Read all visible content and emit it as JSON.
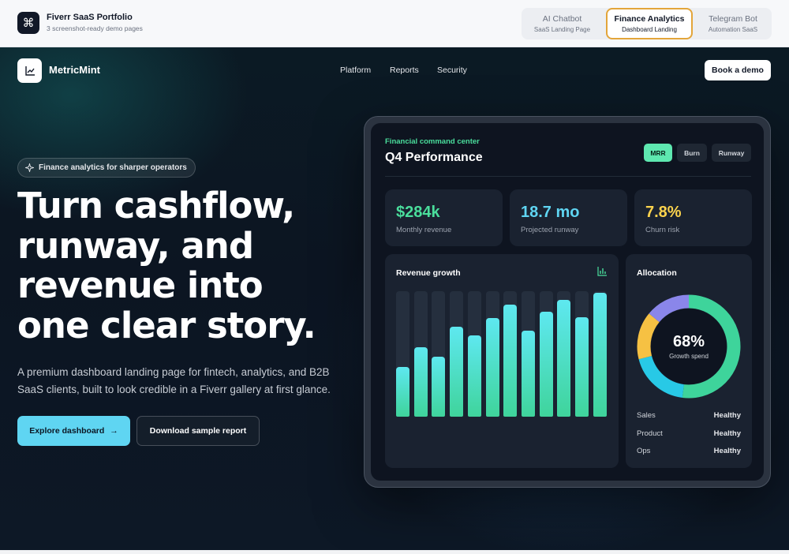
{
  "portfolio": {
    "title": "Fiverr SaaS Portfolio",
    "subtitle": "3 screenshot-ready demo pages",
    "tabs": [
      {
        "label": "AI Chatbot",
        "sub": "SaaS Landing Page",
        "active": false
      },
      {
        "label": "Finance Analytics",
        "sub": "Dashboard Landing",
        "active": true
      },
      {
        "label": "Telegram Bot",
        "sub": "Automation SaaS",
        "active": false
      }
    ]
  },
  "site": {
    "brand": "MetricMint",
    "nav": [
      "Platform",
      "Reports",
      "Security"
    ],
    "cta": "Book a demo"
  },
  "hero": {
    "badge": "Finance analytics for sharper operators",
    "headline": [
      "Turn cashflow,",
      "runway, and",
      "revenue into",
      "one clear story."
    ],
    "lede": "A premium dashboard landing page for fintech, analytics, and B2B SaaS clients, built to look credible in a Fiverr gallery at first glance.",
    "primary_button": "Explore dashboard",
    "secondary_button": "Download sample report"
  },
  "dashboard": {
    "eyebrow": "Financial command center",
    "title": "Q4 Performance",
    "segments": [
      {
        "label": "MRR",
        "active": true
      },
      {
        "label": "Burn",
        "active": false
      },
      {
        "label": "Runway",
        "active": false
      }
    ],
    "stats": [
      {
        "value": "$284k",
        "label": "Monthly revenue",
        "color": "#4ade9c"
      },
      {
        "value": "18.7 mo",
        "label": "Projected runway",
        "color": "#5fd5f2"
      },
      {
        "value": "7.8%",
        "label": "Churn risk",
        "color": "#fcd34d"
      }
    ],
    "revenue_title": "Revenue growth",
    "allocation_title": "Allocation",
    "donut_value": "68%",
    "donut_label": "Growth spend",
    "allocation_rows": [
      {
        "name": "Sales",
        "status": "Healthy"
      },
      {
        "name": "Product",
        "status": "Healthy"
      },
      {
        "name": "Ops",
        "status": "Healthy"
      }
    ]
  },
  "chart_data": [
    {
      "type": "bar",
      "title": "Revenue growth",
      "values": [
        41,
        57,
        49,
        74,
        67,
        81,
        92,
        71,
        86,
        96,
        82,
        102
      ],
      "ylim": [
        0,
        100
      ]
    },
    {
      "type": "pie",
      "title": "Allocation",
      "values": [
        52,
        19,
        15,
        14
      ],
      "colors": [
        "#3ed49b",
        "#28c9e6",
        "#f6c143",
        "#8a86ea"
      ]
    }
  ]
}
